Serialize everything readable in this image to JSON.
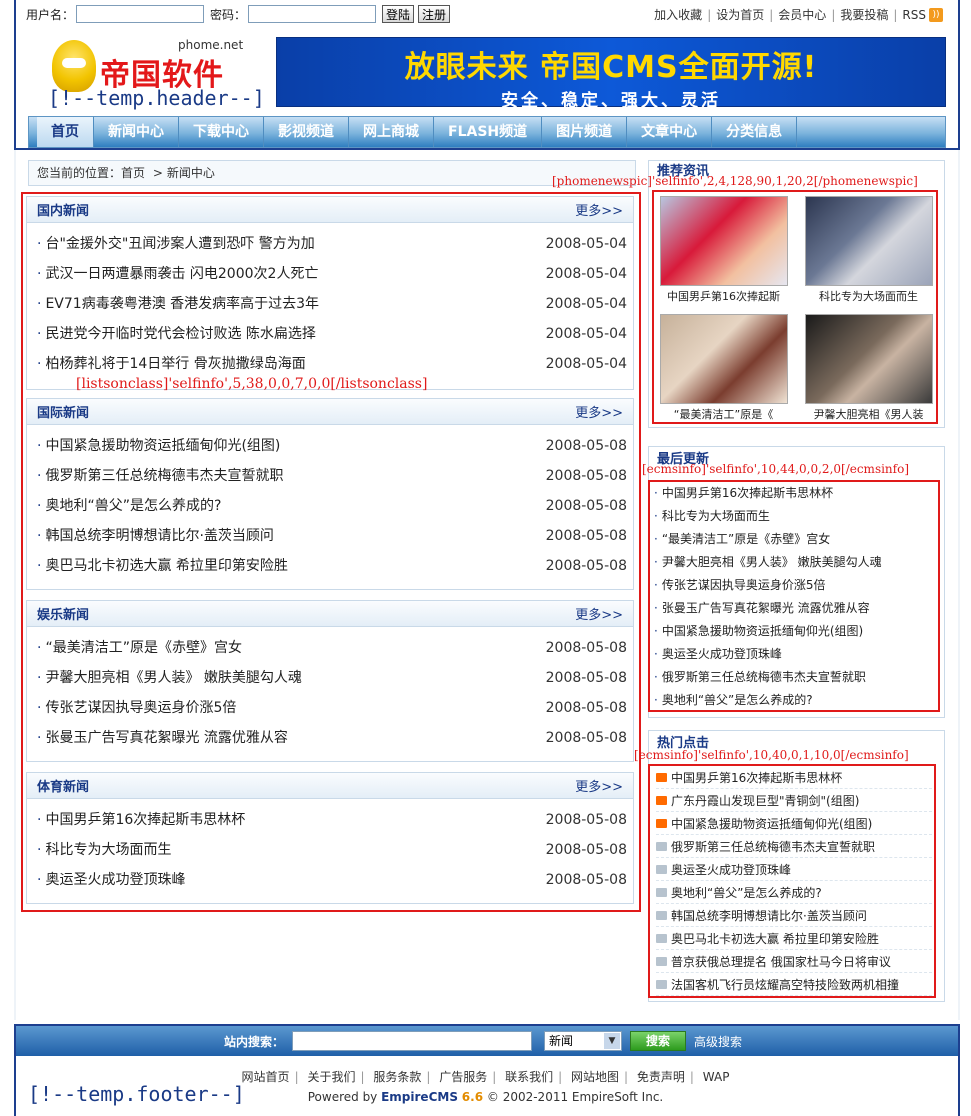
{
  "login": {
    "username_label": "用户名：",
    "password_label": "密码：",
    "login_btn": "登陆",
    "register_btn": "注册"
  },
  "top_links": [
    "加入收藏",
    "设为首页",
    "会员中心",
    "我要投稿",
    "RSS"
  ],
  "logo": {
    "brand": "帝国软件",
    "sub": "phome.net"
  },
  "header_tag": "[!--temp.header--]",
  "banner": {
    "line1": "放眼未来 帝国CMS全面开源!",
    "line2": "安全、稳定、强大、灵活"
  },
  "nav": [
    "首页",
    "新闻中心",
    "下载中心",
    "影视频道",
    "网上商城",
    "FLASH频道",
    "图片频道",
    "文章中心",
    "分类信息"
  ],
  "breadcrumb": {
    "label": "您当前的位置：",
    "home": "首页",
    "sep": ">",
    "current": "新闻中心"
  },
  "more_label": "更多>>",
  "sections": [
    {
      "title": "国内新闻",
      "items": [
        {
          "title": "台\"金援外交\"丑闻涉案人遭到恐吓 警方为加",
          "date": "2008-05-04"
        },
        {
          "title": "武汉一日两遭暴雨袭击 闪电2000次2人死亡",
          "date": "2008-05-04"
        },
        {
          "title": "EV71病毒袭粤港澳 香港发病率高于过去3年",
          "date": "2008-05-04"
        },
        {
          "title": "民进党今开临时党代会检讨败选 陈水扁选择",
          "date": "2008-05-04"
        },
        {
          "title": "柏杨葬礼将于14日举行 骨灰抛撒绿岛海面",
          "date": "2008-05-04"
        }
      ]
    },
    {
      "title": "国际新闻",
      "items": [
        {
          "title": "中国紧急援助物资运抵缅甸仰光(组图)",
          "date": "2008-05-08"
        },
        {
          "title": "俄罗斯第三任总统梅德韦杰夫宣誓就职",
          "date": "2008-05-08"
        },
        {
          "title": "奥地利“兽父”是怎么养成的?",
          "date": "2008-05-08"
        },
        {
          "title": "韩国总统李明博想请比尔·盖茨当顾问",
          "date": "2008-05-08"
        },
        {
          "title": "奥巴马北卡初选大赢 希拉里印第安险胜",
          "date": "2008-05-08"
        }
      ]
    },
    {
      "title": "娱乐新闻",
      "items": [
        {
          "title": "“最美清洁工”原是《赤壁》宫女",
          "date": "2008-05-08"
        },
        {
          "title": "尹馨大胆亮相《男人装》 嫩肤美腿勾人魂",
          "date": "2008-05-08"
        },
        {
          "title": "传张艺谋因执导奥运身价涨5倍",
          "date": "2008-05-08"
        },
        {
          "title": "张曼玉广告写真花絮曝光 流露优雅从容",
          "date": "2008-05-08"
        }
      ]
    },
    {
      "title": "体育新闻",
      "items": [
        {
          "title": "中国男乒第16次捧起斯韦思林杯",
          "date": "2008-05-08"
        },
        {
          "title": "科比专为大场面而生",
          "date": "2008-05-08"
        },
        {
          "title": "奥运圣火成功登顶珠峰",
          "date": "2008-05-08"
        }
      ]
    }
  ],
  "listsonclass_tag": "[listsonclass]'selfinfo',5,38,0,0,7,0,0[/listsonclass]",
  "recommend": {
    "title": "推荐资讯",
    "tag": "[phomenewspic]'selfinfo',2,4,128,90,1,20,2[/phomenewspic]",
    "pics": [
      {
        "caption": "中国男乒第16次捧起斯"
      },
      {
        "caption": "科比专为大场面而生"
      },
      {
        "caption": "“最美清洁工”原是《"
      },
      {
        "caption": "尹馨大胆亮相《男人装"
      }
    ]
  },
  "latest": {
    "title": "最后更新",
    "tag": "[ecmsinfo]'selfinfo',10,44,0,0,2,0[/ecmsinfo]",
    "items": [
      "中国男乒第16次捧起斯韦思林杯",
      "科比专为大场面而生",
      "“最美清洁工”原是《赤壁》宫女",
      "尹馨大胆亮相《男人装》 嫩肤美腿勾人魂",
      "传张艺谋因执导奥运身价涨5倍",
      "张曼玉广告写真花絮曝光 流露优雅从容",
      "中国紧急援助物资运抵缅甸仰光(组图)",
      "奥运圣火成功登顶珠峰",
      "俄罗斯第三任总统梅德韦杰夫宣誓就职",
      "奥地利“兽父”是怎么养成的?"
    ]
  },
  "hot": {
    "title": "热门点击",
    "tag": "[ecmsinfo]'selfinfo',10,40,0,1,10,0[/ecmsinfo]",
    "items": [
      {
        "title": "中国男乒第16次捧起斯韦思林杯",
        "icon": "hot"
      },
      {
        "title": "广东丹霞山发现巨型\"青铜剑\"(组图)",
        "icon": "hot"
      },
      {
        "title": "中国紧急援助物资运抵缅甸仰光(组图)",
        "icon": "hot"
      },
      {
        "title": "俄罗斯第三任总统梅德韦杰夫宣誓就职",
        "icon": "norm"
      },
      {
        "title": "奥运圣火成功登顶珠峰",
        "icon": "norm"
      },
      {
        "title": "奥地利“兽父”是怎么养成的?",
        "icon": "norm"
      },
      {
        "title": "韩国总统李明博想请比尔·盖茨当顾问",
        "icon": "norm"
      },
      {
        "title": "奥巴马北卡初选大赢 希拉里印第安险胜",
        "icon": "norm"
      },
      {
        "title": "普京获俄总理提名 俄国家杜马今日将审议",
        "icon": "norm"
      },
      {
        "title": "法国客机飞行员炫耀高空特技险致两机相撞",
        "icon": "norm"
      }
    ]
  },
  "search": {
    "label": "站内搜索：",
    "select": "新闻",
    "go": "搜索",
    "advanced": "高级搜索"
  },
  "footer_links": [
    "网站首页",
    "关于我们",
    "服务条款",
    "广告服务",
    "联系我们",
    "网站地图",
    "免责声明",
    "WAP"
  ],
  "footer_copy": {
    "pre": "Powered by ",
    "brand": "EmpireCMS",
    "ver": "6.6",
    "post": " © 2002-2011 EmpireSoft Inc."
  },
  "footer_tag": "[!--temp.footer--]",
  "colors": {
    "accent": "#1a3a86",
    "highlight": "#e01a1a",
    "nav": "#2f7ec0"
  }
}
